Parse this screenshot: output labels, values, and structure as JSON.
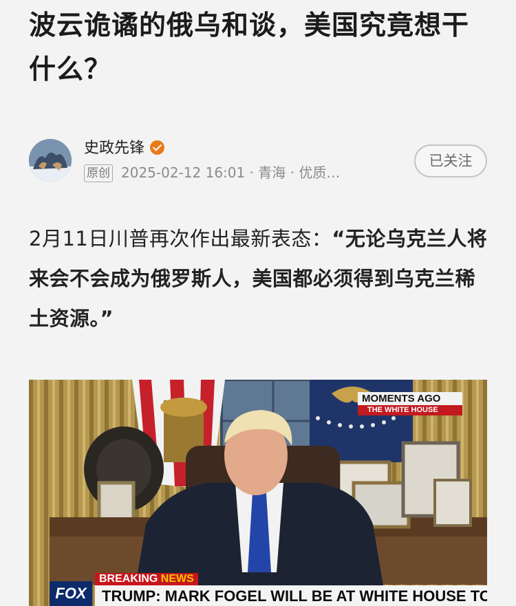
{
  "article": {
    "title": "波云诡谲的俄乌和谈，美国究竟想干什么？",
    "body_plain": "2月11日川普再次作出最新表态：",
    "body_bold": "“无论乌克兰人将来会不会成为俄罗斯人，美国都必须得到乌克兰稀土资源。”"
  },
  "author": {
    "name": "史政先锋",
    "original_tag": "原创",
    "meta": "2025-02-12 16:01 · 青海 · 优质…",
    "follow_label": "已关注"
  },
  "image": {
    "breaking_1": "BREAKING ",
    "breaking_2": "NEWS",
    "headline": "TRUMP: MARK FOGEL WILL BE AT WHITE HOUSE TONIGHT",
    "channel_logo": "FOX",
    "moments_label": "MOMENTS AGO",
    "location_label": "THE WHITE HOUSE"
  },
  "colors": {
    "verified_badge": "#e87a1b",
    "breaking_red": "#c7161b",
    "news_yellow": "#f2c600",
    "fox_blue": "#0d2a6b"
  }
}
